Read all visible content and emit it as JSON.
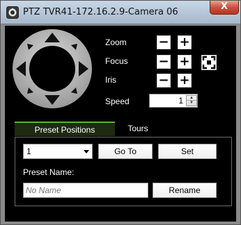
{
  "window": {
    "title": "PTZ  TVR41-172.16.2.9-Camera 06",
    "close_label": "X"
  },
  "controls": {
    "zoom_label": "Zoom",
    "focus_label": "Focus",
    "iris_label": "Iris",
    "speed_label": "Speed",
    "minus_symbol": "−",
    "plus_symbol": "+",
    "speed_value": "1"
  },
  "tabs": {
    "preset_positions": "Preset Positions",
    "tours": "Tours"
  },
  "preset": {
    "selected_value": "1",
    "go_to_label": "Go To",
    "set_label": "Set",
    "name_label": "Preset Name:",
    "name_placeholder": "No Name",
    "rename_label": "Rename"
  },
  "colors": {
    "background": "#000000",
    "tab_accent": "#64b22d",
    "titlebar": "#b3c4d6",
    "close_button": "#c9523f"
  },
  "icons": [
    "camera-app-icon",
    "close-icon",
    "ptz-joystick",
    "fit-focus-icon",
    "spin-up-icon",
    "spin-down-icon",
    "dropdown-arrow-icon"
  ]
}
